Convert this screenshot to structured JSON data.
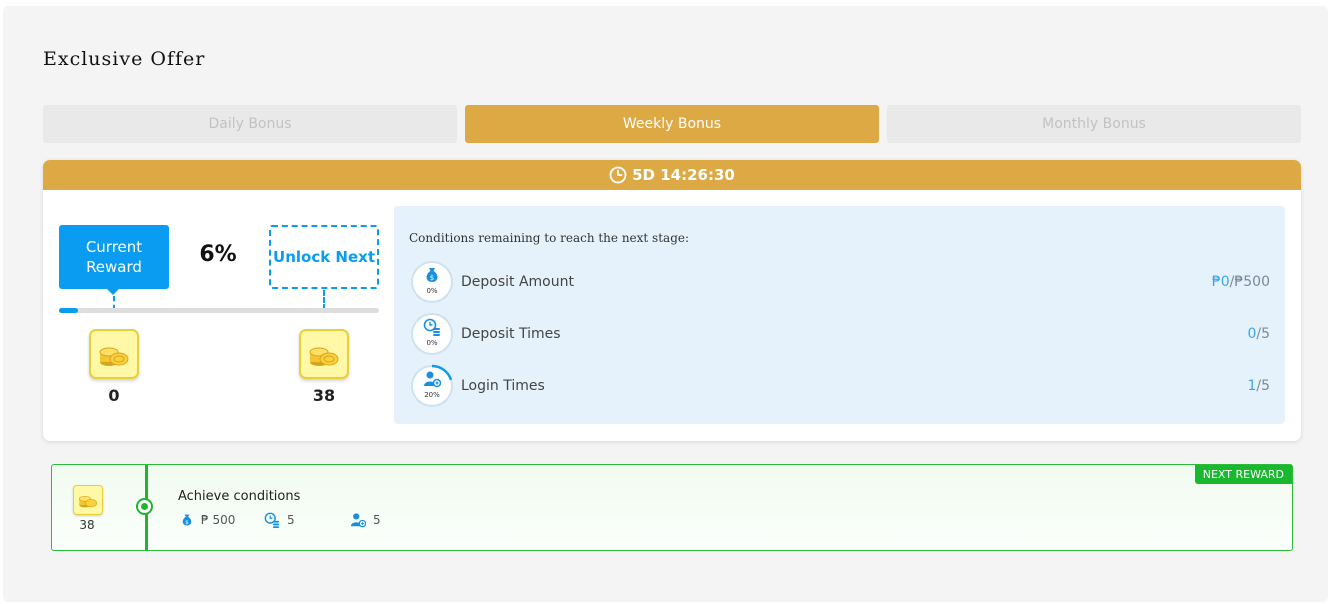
{
  "page": {
    "title": "Exclusive Offer"
  },
  "tabs": [
    {
      "label": "Daily Bonus",
      "active": false
    },
    {
      "label": "Weekly Bonus",
      "active": true
    },
    {
      "label": "Monthly Bonus",
      "active": false
    }
  ],
  "timer": {
    "value": "5D 14:26:30",
    "icon": "clock-icon"
  },
  "progress": {
    "current_label": "Current Reward",
    "next_label": "Unlock Next",
    "percent_text": "6%",
    "percent": 6,
    "current_value": "0",
    "next_value": "38",
    "icon": "coin-stack-icon"
  },
  "conditions": {
    "title": "Conditions remaining to reach the next stage:",
    "items": [
      {
        "label": "Deposit Amount",
        "percent_text": "0%",
        "percent": 0,
        "current": "₱0",
        "separator": "/",
        "target": "₱500",
        "icon": "money-bag-icon"
      },
      {
        "label": "Deposit Times",
        "percent_text": "0%",
        "percent": 0,
        "current": "0",
        "separator": "/",
        "target": "5",
        "icon": "clock-coins-icon"
      },
      {
        "label": "Login Times",
        "percent_text": "20%",
        "percent": 20,
        "current": "1",
        "separator": "/",
        "target": "5",
        "icon": "user-login-icon"
      }
    ]
  },
  "next_reward": {
    "badge": "NEXT REWARD",
    "value": "38",
    "title": "Achieve conditions",
    "requirements": [
      {
        "icon": "money-bag-icon",
        "value": "₱ 500"
      },
      {
        "icon": "clock-coins-icon",
        "value": "5"
      },
      {
        "icon": "user-login-icon",
        "value": "5"
      }
    ]
  },
  "colors": {
    "gold": "#dda944",
    "blue": "#0a9cf0",
    "green": "#1fb52f",
    "light_blue_bg": "#e5f2fc"
  }
}
